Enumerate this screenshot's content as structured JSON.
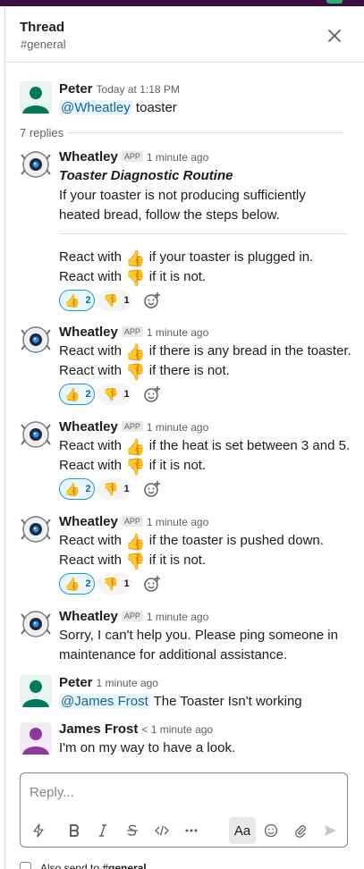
{
  "header": {
    "title": "Thread",
    "channel": "#general",
    "close_icon": "close-icon"
  },
  "parent": {
    "author": "Peter",
    "time": "Today at 1:18 PM",
    "mention": "@Wheatley",
    "text": " toaster"
  },
  "replies_label": "7 replies",
  "app_badge": "APP",
  "emoji": {
    "thumbs_up": "👍",
    "thumbs_down": "👎"
  },
  "reactions": {
    "up_count": "2",
    "down_count": "1"
  },
  "messages": [
    {
      "author": "Wheatley",
      "time": "1 minute ago",
      "title": "Toaster Diagnostic Routine",
      "intro1": "If your toaster is not producing sufficiently",
      "intro2": "heated bread, follow the steps below.",
      "up_text": " if your toaster is plugged in.",
      "down_text": " if it is not."
    },
    {
      "author": "Wheatley",
      "time": "1 minute ago",
      "up_text": " if there is any bread in the toaster.",
      "down_text": " if there is not."
    },
    {
      "author": "Wheatley",
      "time": "1 minute ago",
      "up_text": " if the heat is set between 3 and 5.",
      "down_text": " if it is not."
    },
    {
      "author": "Wheatley",
      "time": "1 minute ago",
      "up_text": " if the toaster is pushed down.",
      "down_text": " if it is not."
    },
    {
      "author": "Wheatley",
      "time": "1 minute ago",
      "line1": "Sorry, I can't help you. Please ping someone in",
      "line2": "maintenance for additional assistance."
    },
    {
      "author": "Peter",
      "time": "1 minute ago",
      "mention": "@James Frost",
      "text": " The Toaster Isn't working"
    },
    {
      "author": "James Frost",
      "time": "< 1 minute ago",
      "text": "I'm on my way to have a look."
    }
  ],
  "react_with": "React with",
  "composer": {
    "placeholder": "Reply...",
    "format_button_label": "Aa",
    "tools": [
      "shortcuts-icon",
      "bold-icon",
      "italic-icon",
      "strikethrough-icon",
      "code-icon",
      "more-icon",
      "format-icon",
      "emoji-icon",
      "attach-icon",
      "send-icon"
    ]
  },
  "also_send": {
    "prefix": "Also send to ",
    "channel": "#general"
  },
  "colors": {
    "aubergine": "#3f0e40",
    "link": "#1264a3",
    "reaction_border": "#1d9bd1",
    "peter_avatar": "#007a5a",
    "james_avatar": "#8d3a9c"
  }
}
